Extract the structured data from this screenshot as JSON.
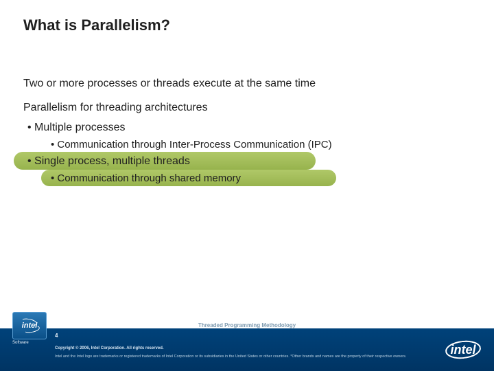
{
  "title": "What is Parallelism?",
  "body": {
    "line1": "Two or more processes or threads execute at the same time",
    "line2": "Parallelism for threading architectures",
    "bullet1": "Multiple processes",
    "bullet1a": "Communication through Inter-Process Communication (IPC)",
    "bullet2": "Single process, multiple threads",
    "bullet2a": "Communication through shared memory"
  },
  "footer": {
    "course": "Threaded Programming Methodology",
    "badge_text": "intel",
    "badge_sub": "Software",
    "slide_number": "4",
    "copyright": "Copyright © 2006, Intel Corporation. All rights reserved.",
    "disclaimer": "Intel and the Intel logo are trademarks or registered trademarks of Intel Corporation or its subsidiaries in the United States or other countries. *Other brands and names are the property of their respective owners.",
    "logo_text": "intel"
  }
}
